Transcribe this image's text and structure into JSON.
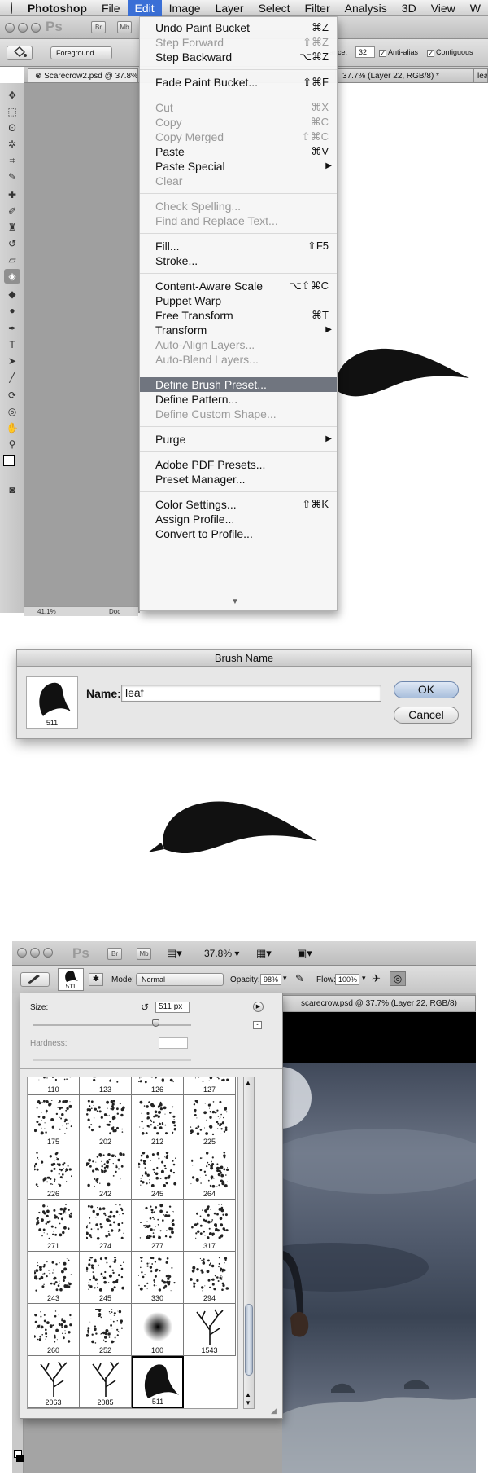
{
  "menubar": {
    "app_name": "Photoshop",
    "menus": [
      "File",
      "Edit",
      "Image",
      "Layer",
      "Select",
      "Filter",
      "Analysis",
      "3D",
      "View",
      "W"
    ],
    "active_menu": "Edit"
  },
  "appbar": {
    "bridge_btn": "Br",
    "minibridge_btn": "Mb",
    "ps_logo": "Ps"
  },
  "options_bar_1": {
    "preset_label": "Foreground",
    "tolerance_label": "ance:",
    "tolerance_value": "32",
    "antialias_label": "Anti-alias",
    "contiguous_label": "Contiguous"
  },
  "document_tabs_1": [
    {
      "label": "Scarecrow2.psd @ 37.8%"
    },
    {
      "label": "37.7% (Layer 22, RGB/8) *"
    },
    {
      "label": "leaf."
    }
  ],
  "status_1": {
    "zoom": "41.1%",
    "doc": "Doc"
  },
  "edit_menu": {
    "groups": [
      [
        {
          "label": "Undo Paint Bucket",
          "shortcut": "⌘Z",
          "enabled": true
        },
        {
          "label": "Step Forward",
          "shortcut": "⇧⌘Z",
          "enabled": false
        },
        {
          "label": "Step Backward",
          "shortcut": "⌥⌘Z",
          "enabled": true
        }
      ],
      [
        {
          "label": "Fade Paint Bucket...",
          "shortcut": "⇧⌘F",
          "enabled": true
        }
      ],
      [
        {
          "label": "Cut",
          "shortcut": "⌘X",
          "enabled": false
        },
        {
          "label": "Copy",
          "shortcut": "⌘C",
          "enabled": false
        },
        {
          "label": "Copy Merged",
          "shortcut": "⇧⌘C",
          "enabled": false
        },
        {
          "label": "Paste",
          "shortcut": "⌘V",
          "enabled": true
        },
        {
          "label": "Paste Special",
          "submenu": true,
          "enabled": true
        },
        {
          "label": "Clear",
          "enabled": false
        }
      ],
      [
        {
          "label": "Check Spelling...",
          "enabled": false
        },
        {
          "label": "Find and Replace Text...",
          "enabled": false
        }
      ],
      [
        {
          "label": "Fill...",
          "shortcut": "⇧F5",
          "enabled": true
        },
        {
          "label": "Stroke...",
          "enabled": true
        }
      ],
      [
        {
          "label": "Content-Aware Scale",
          "shortcut": "⌥⇧⌘C",
          "enabled": true
        },
        {
          "label": "Puppet Warp",
          "enabled": true
        },
        {
          "label": "Free Transform",
          "shortcut": "⌘T",
          "enabled": true
        },
        {
          "label": "Transform",
          "submenu": true,
          "enabled": true
        },
        {
          "label": "Auto-Align Layers...",
          "enabled": false
        },
        {
          "label": "Auto-Blend Layers...",
          "enabled": false
        }
      ],
      [
        {
          "label": "Define Brush Preset...",
          "enabled": true,
          "highlighted": true
        },
        {
          "label": "Define Pattern...",
          "enabled": true
        },
        {
          "label": "Define Custom Shape...",
          "enabled": false
        }
      ],
      [
        {
          "label": "Purge",
          "submenu": true,
          "enabled": true
        }
      ],
      [
        {
          "label": "Adobe PDF Presets...",
          "enabled": true
        },
        {
          "label": "Preset Manager...",
          "enabled": true
        }
      ],
      [
        {
          "label": "Color Settings...",
          "shortcut": "⇧⌘K",
          "enabled": true
        },
        {
          "label": "Assign Profile...",
          "enabled": true
        },
        {
          "label": "Convert to Profile...",
          "enabled": true
        }
      ]
    ],
    "scroll_arrow": "▼"
  },
  "brush_dialog": {
    "title": "Brush Name",
    "thumbnail_size": "511",
    "name_label": "Name:",
    "name_value": "leaf",
    "ok_label": "OK",
    "cancel_label": "Cancel"
  },
  "appbar_3": {
    "ps_logo": "Ps",
    "bridge_btn": "Br",
    "minibridge_btn": "Mb",
    "zoom": "37.8%"
  },
  "options_bar_3": {
    "brush_size_badge": "511",
    "mode_label": "Mode:",
    "mode_value": "Normal",
    "opacity_label": "Opacity:",
    "opacity_value": "98%",
    "flow_label": "Flow:",
    "flow_value": "100%"
  },
  "document_tab_3": {
    "label": "scarecrow.psd @ 37.7% (Layer 22, RGB/8)"
  },
  "brush_picker": {
    "size_label": "Size:",
    "size_value": "511 px",
    "size_fraction": 0.78,
    "hardness_label": "Hardness:",
    "hardness_value": "",
    "brushes": [
      {
        "size": "110"
      },
      {
        "size": "123"
      },
      {
        "size": "126"
      },
      {
        "size": "127"
      },
      {
        "size": "175"
      },
      {
        "size": "202"
      },
      {
        "size": "212"
      },
      {
        "size": "225"
      },
      {
        "size": "226"
      },
      {
        "size": "242"
      },
      {
        "size": "245"
      },
      {
        "size": "264"
      },
      {
        "size": "271"
      },
      {
        "size": "274"
      },
      {
        "size": "277"
      },
      {
        "size": "317"
      },
      {
        "size": "243"
      },
      {
        "size": "245"
      },
      {
        "size": "330"
      },
      {
        "size": "294"
      },
      {
        "size": "260"
      },
      {
        "size": "252"
      },
      {
        "size": "100"
      },
      {
        "size": "1543"
      },
      {
        "size": "2063"
      },
      {
        "size": "2085"
      },
      {
        "size": "511",
        "selected": true
      }
    ]
  },
  "colors": {
    "menu_highlight": "#70757f",
    "mac_selection": "#3a6fd6",
    "leaf_fill": "#111111",
    "dialog_bg": "#e7e7e7"
  }
}
